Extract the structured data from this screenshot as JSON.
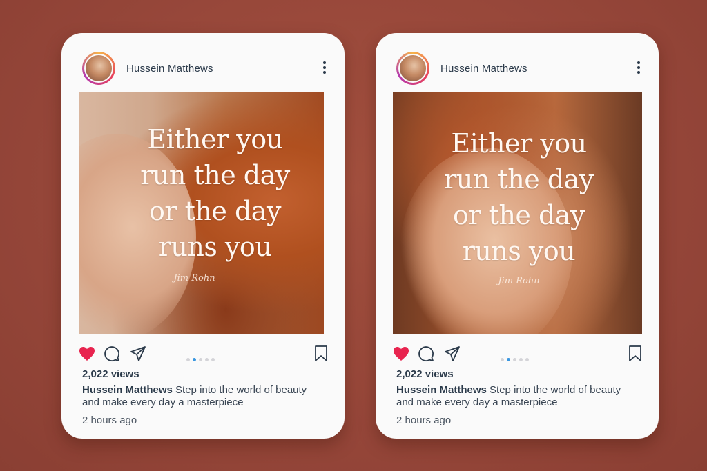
{
  "posts": [
    {
      "username": "Hussein Matthews",
      "quote_lines": [
        "Either you",
        "run the day",
        "or the day",
        "runs you"
      ],
      "signature": "Jim Rohn",
      "views": "2,022 views",
      "caption_user": "Hussein Matthews",
      "caption_text": " Step into the world of beauty and make every day a masterpiece",
      "time": "2 hours ago",
      "carousel_active": 1,
      "carousel_count": 5
    },
    {
      "username": "Hussein Matthews",
      "quote_lines": [
        "Either you",
        "run the day",
        "or the day",
        "runs you"
      ],
      "signature": "Jim Rohn",
      "views": "2,022 views",
      "caption_user": "Hussein Matthews",
      "caption_text": " Step into the world of beauty and make every day a masterpiece",
      "time": "2 hours ago",
      "carousel_active": 1,
      "carousel_count": 5
    }
  ],
  "icons": {
    "more": "more-vertical-icon",
    "like": "heart-icon",
    "comment": "comment-icon",
    "share": "send-icon",
    "save": "bookmark-icon"
  },
  "colors": {
    "background": "#97473a",
    "card": "#fafafa",
    "heart": "#e8244f",
    "active_dot": "#3a97e0",
    "text": "#2b3a4a"
  }
}
